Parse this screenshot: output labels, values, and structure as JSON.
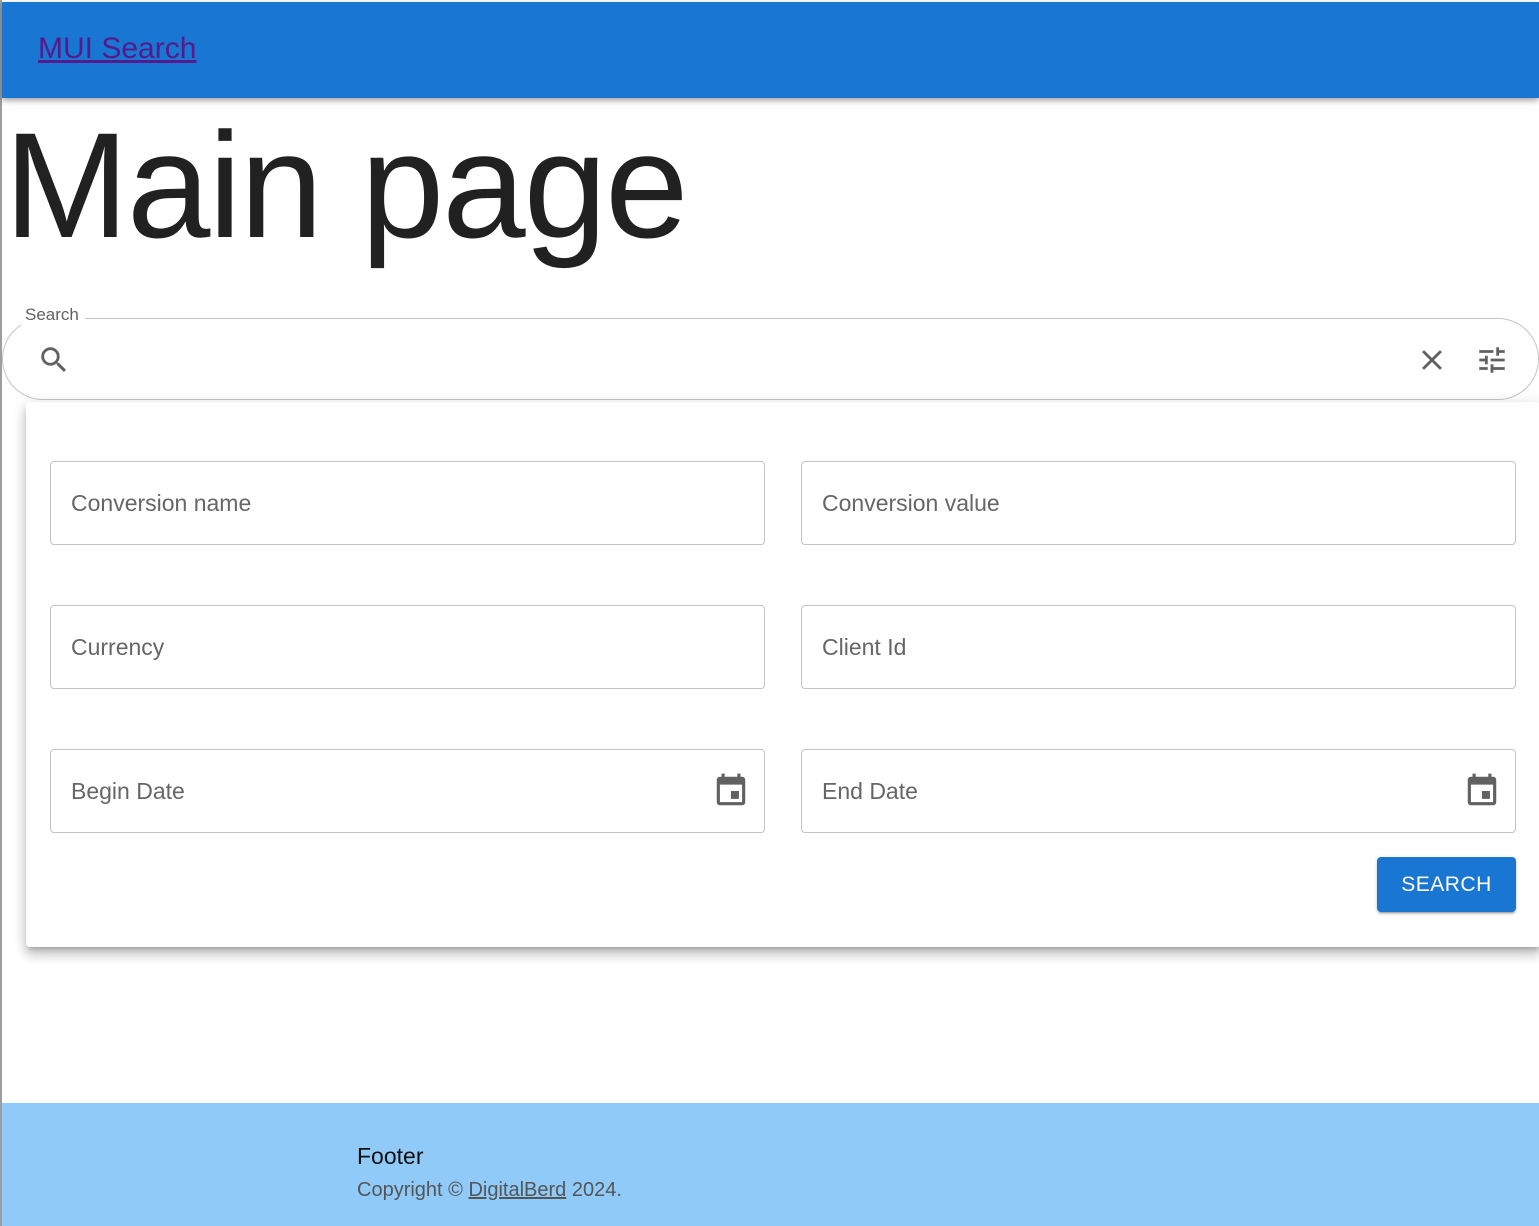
{
  "appbar": {
    "title": "MUI Search"
  },
  "page": {
    "title": "Main page"
  },
  "search": {
    "label": "Search",
    "value": ""
  },
  "filters": {
    "conversion_name": "Conversion name",
    "conversion_value": "Conversion value",
    "currency": "Currency",
    "client_id": "Client Id",
    "begin_date": "Begin Date",
    "end_date": "End Date",
    "submit_label": "SEARCH"
  },
  "footer": {
    "title": "Footer",
    "copyright_prefix": "Copyright ©",
    "company": "DigitalBerd",
    "year_suffix": "2024."
  },
  "colors": {
    "primary": "#1976d2",
    "footer_bg": "#90caf9",
    "link_visited": "#551a8b"
  },
  "icons": {
    "search": "search-icon",
    "clear": "close-icon",
    "filter": "tune-icon",
    "date": "calendar-icon"
  }
}
